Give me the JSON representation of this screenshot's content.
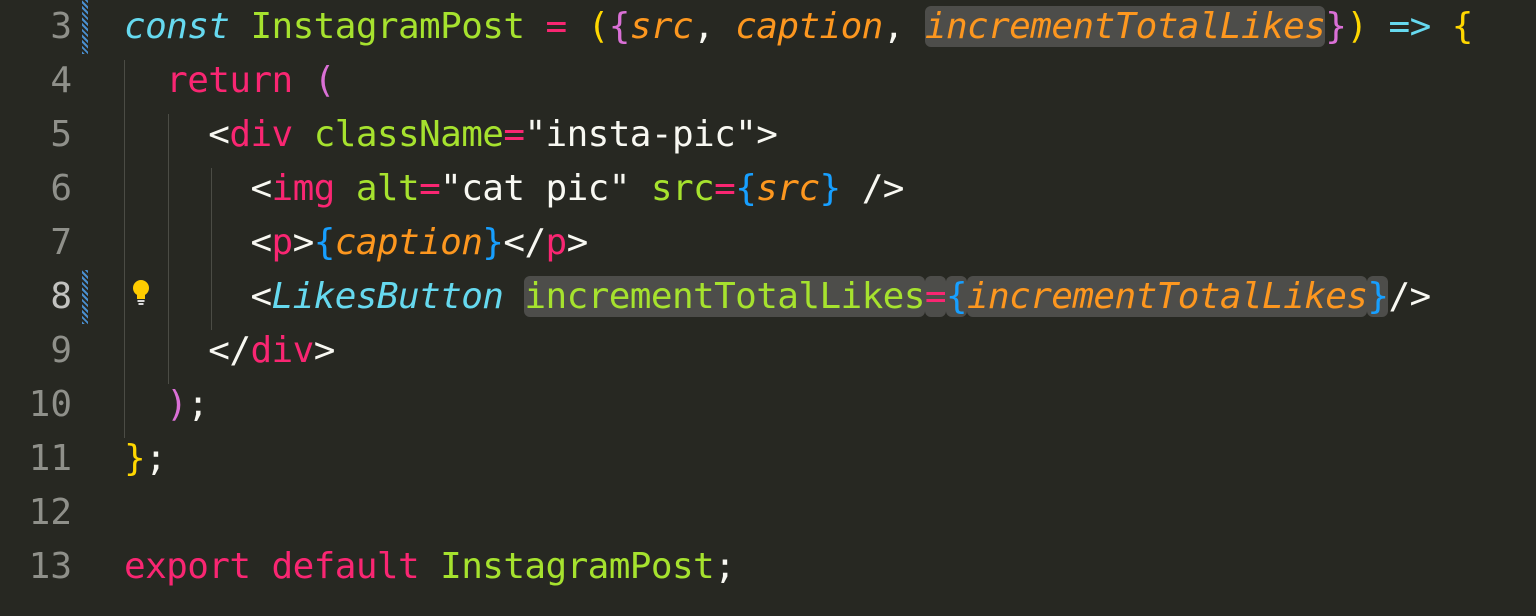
{
  "editor": {
    "lines": [
      {
        "num": "3",
        "modified": true
      },
      {
        "num": "4",
        "modified": false
      },
      {
        "num": "5",
        "modified": false
      },
      {
        "num": "6",
        "modified": false
      },
      {
        "num": "7",
        "modified": false
      },
      {
        "num": "8",
        "modified": true,
        "active": true,
        "lightbulb": true
      },
      {
        "num": "9",
        "modified": false
      },
      {
        "num": "10",
        "modified": false
      },
      {
        "num": "11",
        "modified": false
      },
      {
        "num": "12",
        "modified": false
      },
      {
        "num": "13",
        "modified": false
      }
    ],
    "tokens": {
      "l3": [
        [
          "const",
          "kw"
        ],
        [
          " ",
          ""
        ],
        [
          "InstagramPost",
          "cls"
        ],
        [
          " ",
          ""
        ],
        [
          "=",
          "op"
        ],
        [
          " ",
          ""
        ],
        [
          "(",
          "b1"
        ],
        [
          "{",
          "b2"
        ],
        [
          "src",
          "prm"
        ],
        [
          ", ",
          "pun"
        ],
        [
          "caption",
          "prm"
        ],
        [
          ", ",
          "pun"
        ],
        [
          "incrementTotalLikes",
          "prm hl"
        ],
        [
          "}",
          "b2"
        ],
        [
          ")",
          "b1"
        ],
        [
          " ",
          ""
        ],
        [
          "=>",
          "kw-arrow"
        ],
        [
          " ",
          ""
        ],
        [
          "{",
          "b1"
        ]
      ],
      "l4": [
        [
          "  ",
          ""
        ],
        [
          "return",
          "kwr"
        ],
        [
          " ",
          ""
        ],
        [
          "(",
          "b2"
        ]
      ],
      "l5": [
        [
          "    ",
          ""
        ],
        [
          "<",
          "pun"
        ],
        [
          "div",
          "tag"
        ],
        [
          " ",
          ""
        ],
        [
          "className",
          "attr"
        ],
        [
          "=",
          "op"
        ],
        [
          "\"insta-pic\"",
          "str-w"
        ],
        [
          ">",
          "pun"
        ]
      ],
      "l6": [
        [
          "      ",
          ""
        ],
        [
          "<",
          "pun"
        ],
        [
          "img",
          "tag"
        ],
        [
          " ",
          ""
        ],
        [
          "alt",
          "attr"
        ],
        [
          "=",
          "op"
        ],
        [
          "\"cat pic\"",
          "str-w"
        ],
        [
          " ",
          ""
        ],
        [
          "src",
          "attr"
        ],
        [
          "=",
          "op"
        ],
        [
          "{",
          "b3"
        ],
        [
          "src",
          "prm"
        ],
        [
          "}",
          "b3"
        ],
        [
          " ",
          ""
        ],
        [
          "/>",
          "pun"
        ]
      ],
      "l7": [
        [
          "      ",
          ""
        ],
        [
          "<",
          "pun"
        ],
        [
          "p",
          "tag"
        ],
        [
          ">",
          "pun"
        ],
        [
          "{",
          "b3"
        ],
        [
          "caption",
          "prm"
        ],
        [
          "}",
          "b3"
        ],
        [
          "</",
          "pun"
        ],
        [
          "p",
          "tag"
        ],
        [
          ">",
          "pun"
        ]
      ],
      "l8": [
        [
          "      ",
          ""
        ],
        [
          "<",
          "pun"
        ],
        [
          "LikesButton",
          "cls-it"
        ],
        [
          " ",
          ""
        ],
        [
          "incrementTotalLikes",
          "attr hl"
        ],
        [
          "=",
          "op hl"
        ],
        [
          "{",
          "b3 hl"
        ],
        [
          "incrementTotalLikes",
          "prm hl"
        ],
        [
          "}",
          "b3 hl"
        ],
        [
          "/>",
          "pun"
        ]
      ],
      "l9": [
        [
          "    ",
          ""
        ],
        [
          "</",
          "pun"
        ],
        [
          "div",
          "tag"
        ],
        [
          ">",
          "pun"
        ]
      ],
      "l10": [
        [
          "  ",
          ""
        ],
        [
          ")",
          "b2"
        ],
        [
          ";",
          "pun"
        ]
      ],
      "l11": [
        [
          "}",
          "b1"
        ],
        [
          ";",
          "pun"
        ]
      ],
      "l12": [],
      "l13": [
        [
          "export",
          "kwr"
        ],
        [
          " ",
          ""
        ],
        [
          "default",
          "kwr"
        ],
        [
          " ",
          ""
        ],
        [
          "InstagramPost",
          "cls"
        ],
        [
          ";",
          "pun"
        ]
      ]
    }
  }
}
